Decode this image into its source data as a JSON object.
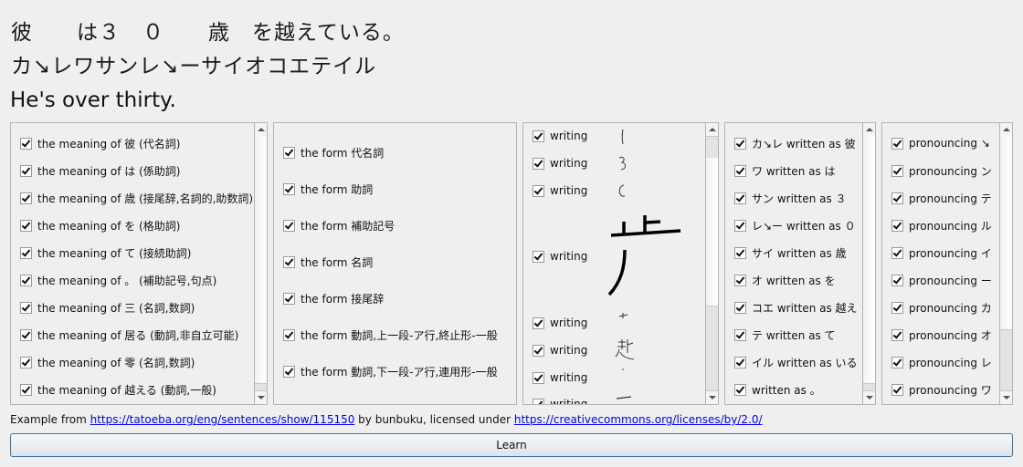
{
  "sentence": {
    "japanese": "彼　　は３　０　　歳　を越えている。",
    "reading": "カ↘レワサンレ↘ーサイオコエテイル",
    "english": "He's over thirty."
  },
  "meanings_panel": {
    "items": [
      {
        "label": "the meaning of 彼 (代名詞)",
        "checked": true
      },
      {
        "label": "the meaning of は (係助詞)",
        "checked": true
      },
      {
        "label": "the meaning of 歳 (接尾辞,名詞的,助数詞)",
        "checked": true
      },
      {
        "label": "the meaning of を (格助詞)",
        "checked": true
      },
      {
        "label": "the meaning of て (接続助詞)",
        "checked": true
      },
      {
        "label": "the meaning of 。 (補助記号,句点)",
        "checked": true
      },
      {
        "label": "the meaning of 三 (名詞,数詞)",
        "checked": true
      },
      {
        "label": "the meaning of 居る (動詞,非自立可能)",
        "checked": true
      },
      {
        "label": "the meaning of 零 (名詞,数詞)",
        "checked": true
      },
      {
        "label": "the meaning of 越える (動詞,一般)",
        "checked": true
      }
    ]
  },
  "forms_panel": {
    "items": [
      {
        "label": "the form 代名詞",
        "checked": true
      },
      {
        "label": "the form 助詞",
        "checked": true
      },
      {
        "label": "the form 補助記号",
        "checked": true
      },
      {
        "label": "the form 名詞",
        "checked": true
      },
      {
        "label": "the form 接尾辞",
        "checked": true
      },
      {
        "label": "the form 動詞,上一段-ア行,終止形-一般",
        "checked": true
      },
      {
        "label": "the form 動詞,下一段-ア行,連用形-一般",
        "checked": true
      }
    ]
  },
  "writing_panel": {
    "items": [
      {
        "label": "writing",
        "checked": true,
        "glyph": "1"
      },
      {
        "label": "writing",
        "checked": true,
        "glyph": "3"
      },
      {
        "label": "writing",
        "checked": true,
        "glyph": "0"
      },
      {
        "label": "writing",
        "checked": true,
        "glyph": "歳"
      },
      {
        "label": "writing",
        "checked": true,
        "glyph": "を"
      },
      {
        "label": "writing",
        "checked": true,
        "glyph": "越"
      },
      {
        "label": "writing",
        "checked": true,
        "glyph": "え"
      },
      {
        "label": "writing",
        "checked": true,
        "glyph": "て"
      }
    ]
  },
  "written_as_panel": {
    "items": [
      {
        "label": "カ↘レ written as 彼",
        "checked": true
      },
      {
        "label": "ワ written as は",
        "checked": true
      },
      {
        "label": "サン written as ３",
        "checked": true
      },
      {
        "label": "レ↘ー written as ０",
        "checked": true
      },
      {
        "label": "サイ written as 歳",
        "checked": true
      },
      {
        "label": "オ written as を",
        "checked": true
      },
      {
        "label": "コエ written as 越え",
        "checked": true
      },
      {
        "label": "テ written as て",
        "checked": true
      },
      {
        "label": "イル written as いる",
        "checked": true
      },
      {
        "label": " written as 。",
        "checked": true
      }
    ]
  },
  "pronouncing_panel": {
    "items": [
      {
        "label": "pronouncing ↘",
        "checked": true
      },
      {
        "label": "pronouncing ン",
        "checked": true
      },
      {
        "label": "pronouncing テ",
        "checked": true
      },
      {
        "label": "pronouncing ル",
        "checked": true
      },
      {
        "label": "pronouncing イ",
        "checked": true
      },
      {
        "label": "pronouncing ー",
        "checked": true
      },
      {
        "label": "pronouncing カ",
        "checked": true
      },
      {
        "label": "pronouncing オ",
        "checked": true
      },
      {
        "label": "pronouncing レ",
        "checked": true
      },
      {
        "label": "pronouncing ワ",
        "checked": true
      }
    ]
  },
  "attribution": {
    "prefix": "Example from ",
    "source_link": "https://tatoeba.org/eng/sentences/show/115150",
    "middle": " by bunbuku, licensed under ",
    "license_link": "https://creativecommons.org/licenses/by/2.0/"
  },
  "learn_button": {
    "label": "Learn"
  }
}
